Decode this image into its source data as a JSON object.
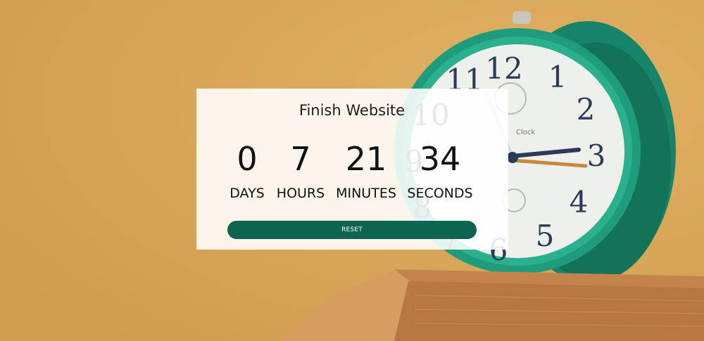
{
  "title": "Finish Website",
  "countdown": [
    {
      "value": "0",
      "label": "DAYS"
    },
    {
      "value": "7",
      "label": "HOURS"
    },
    {
      "value": "21",
      "label": "MINUTES"
    },
    {
      "value": "34",
      "label": "SECONDS"
    }
  ],
  "reset_label": "RESET",
  "colors": {
    "background": "#d9a757",
    "button": "#0d6550",
    "clock_body": "#1f9c7b"
  },
  "background_image": {
    "icon": "alarm-clock-photo",
    "clock_numerals": [
      "12",
      "1",
      "2",
      "3",
      "4",
      "5",
      "6",
      "7",
      "8",
      "9",
      "10",
      "11"
    ],
    "dial_text": "Clock"
  }
}
